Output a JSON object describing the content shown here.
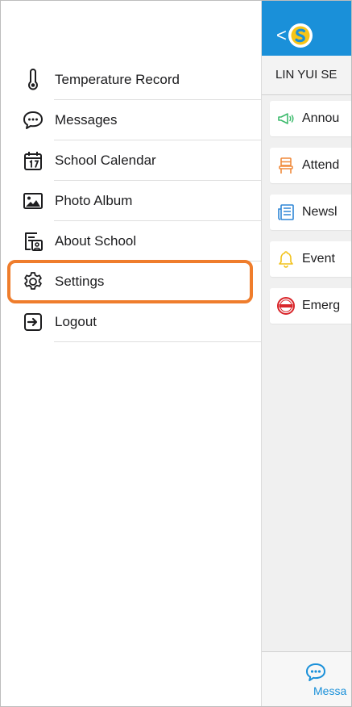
{
  "drawer": {
    "items": [
      {
        "label": "Temperature Record",
        "icon": "thermometer-icon"
      },
      {
        "label": "Messages",
        "icon": "chat-bubble-icon"
      },
      {
        "label": "School Calendar",
        "icon": "calendar-icon"
      },
      {
        "label": "Photo Album",
        "icon": "photo-icon"
      },
      {
        "label": "About School",
        "icon": "profile-card-icon"
      },
      {
        "label": "Settings",
        "icon": "gear-icon",
        "highlighted": true
      },
      {
        "label": "Logout",
        "icon": "logout-icon"
      }
    ]
  },
  "header": {
    "back_symbol": "<",
    "school_name": "LIN YUI SE"
  },
  "modules": [
    {
      "label": "Annou",
      "icon": "megaphone-icon"
    },
    {
      "label": "Attend",
      "icon": "chair-icon"
    },
    {
      "label": "Newsl",
      "icon": "newsletter-icon"
    },
    {
      "label": "Event",
      "icon": "bell-icon"
    },
    {
      "label": "Emerg",
      "icon": "urgent-stamp-icon"
    }
  ],
  "tabbar": {
    "label": "Messa"
  },
  "colors": {
    "accent": "#1a90d9",
    "highlight": "#ef7d2c",
    "logo_yellow": "#f5c518"
  }
}
